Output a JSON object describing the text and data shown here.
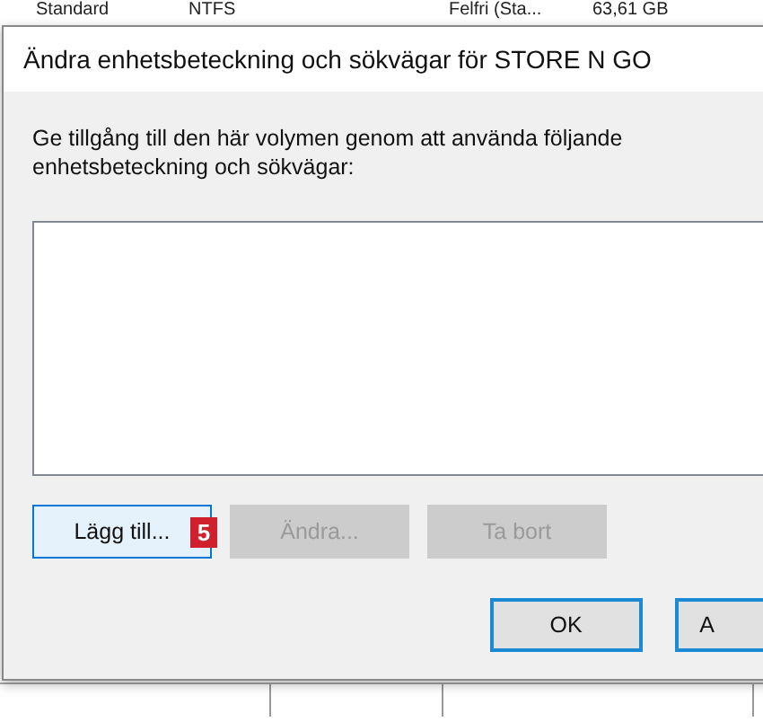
{
  "background_row": [
    "Standard",
    "NTFS",
    "Felfri (Sta...",
    "63,61 GB"
  ],
  "dialog": {
    "title": "Ändra enhetsbeteckning och sökvägar för STORE N GO",
    "description": "Ge tillgång till den här volymen genom att använda följande enhetsbeteckning och sökvägar:",
    "actions": [
      {
        "label": "Lägg till...",
        "disabled": false,
        "focused": true
      },
      {
        "label": "Ändra...",
        "disabled": true,
        "focused": false
      },
      {
        "label": "Ta bort",
        "disabled": true,
        "focused": false
      }
    ],
    "step_badge": "5",
    "buttons": [
      {
        "label": "OK"
      },
      {
        "label": "A"
      }
    ]
  }
}
